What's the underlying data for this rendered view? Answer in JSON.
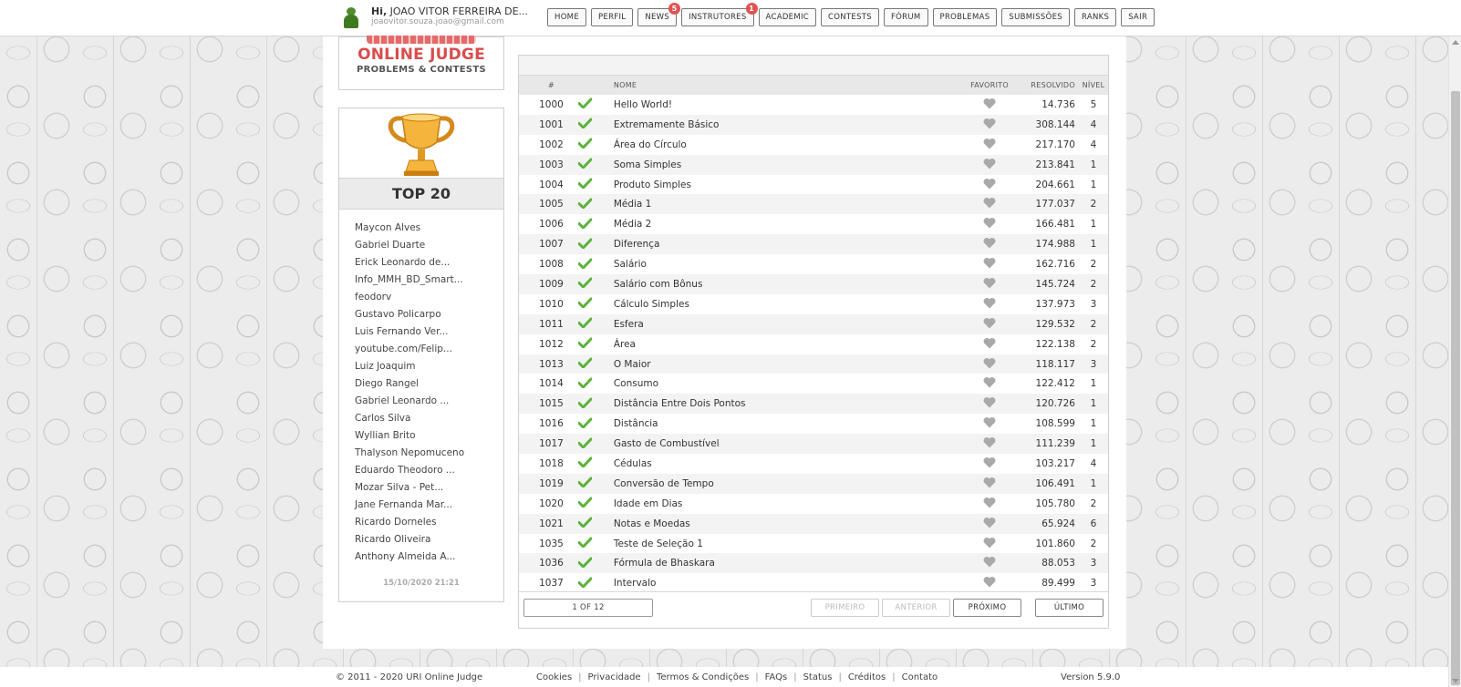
{
  "user": {
    "greeting": "Hi,",
    "name": "JOAO VITOR FERREIRA DE...",
    "email": "joaovitor.souza.joao@gmail.com"
  },
  "nav": [
    {
      "label": "HOME",
      "badge": null
    },
    {
      "label": "PERFIL",
      "badge": null
    },
    {
      "label": "NEWS",
      "badge": "5"
    },
    {
      "label": "INSTRUTORES",
      "badge": "1"
    },
    {
      "label": "ACADEMIC",
      "badge": null
    },
    {
      "label": "CONTESTS",
      "badge": null
    },
    {
      "label": "FÓRUM",
      "badge": null
    },
    {
      "label": "PROBLEMAS",
      "badge": null
    },
    {
      "label": "SUBMISSÕES",
      "badge": null
    },
    {
      "label": "RANKS",
      "badge": null
    },
    {
      "label": "SAIR",
      "badge": null
    }
  ],
  "logo": {
    "title": "ONLINE JUDGE",
    "subtitle": "PROBLEMS & CONTESTS"
  },
  "top20": {
    "title": "TOP 20",
    "users": [
      "Maycon Alves",
      "Gabriel Duarte",
      "Erick Leonardo de...",
      "Info_MMH_BD_Smart...",
      "feodorv",
      "Gustavo Policarpo",
      "Luis Fernando Ver...",
      "youtube.com/Felip...",
      "Luiz Joaquim",
      "Diego Rangel",
      "Gabriel Leonardo ...",
      "Carlos Silva",
      "Wyllian Brito",
      "Thalyson Nepomuceno",
      "Eduardo Theodoro ...",
      "Mozar Silva - Pet...",
      "Jane Fernanda Mar...",
      "Ricardo Dorneles",
      "Ricardo Oliveira",
      "Anthony Almeida A..."
    ],
    "updated": "15/10/2020 21:21"
  },
  "table": {
    "headers": {
      "id": "#",
      "name": "NOME",
      "fav": "FAVORITO",
      "solved": "RESOLVIDO",
      "level": "NÍVEL"
    },
    "rows": [
      {
        "id": "1000",
        "name": "Hello World!",
        "solved": "14.736",
        "level": "5"
      },
      {
        "id": "1001",
        "name": "Extremamente Básico",
        "solved": "308.144",
        "level": "4"
      },
      {
        "id": "1002",
        "name": "Área do Círculo",
        "solved": "217.170",
        "level": "4"
      },
      {
        "id": "1003",
        "name": "Soma Simples",
        "solved": "213.841",
        "level": "1"
      },
      {
        "id": "1004",
        "name": "Produto Simples",
        "solved": "204.661",
        "level": "1"
      },
      {
        "id": "1005",
        "name": "Média 1",
        "solved": "177.037",
        "level": "2"
      },
      {
        "id": "1006",
        "name": "Média 2",
        "solved": "166.481",
        "level": "1"
      },
      {
        "id": "1007",
        "name": "Diferença",
        "solved": "174.988",
        "level": "1"
      },
      {
        "id": "1008",
        "name": "Salário",
        "solved": "162.716",
        "level": "2"
      },
      {
        "id": "1009",
        "name": "Salário com Bônus",
        "solved": "145.724",
        "level": "2"
      },
      {
        "id": "1010",
        "name": "Cálculo Simples",
        "solved": "137.973",
        "level": "3"
      },
      {
        "id": "1011",
        "name": "Esfera",
        "solved": "129.532",
        "level": "2"
      },
      {
        "id": "1012",
        "name": "Área",
        "solved": "122.138",
        "level": "2"
      },
      {
        "id": "1013",
        "name": "O Maior",
        "solved": "118.117",
        "level": "3"
      },
      {
        "id": "1014",
        "name": "Consumo",
        "solved": "122.412",
        "level": "1"
      },
      {
        "id": "1015",
        "name": "Distância Entre Dois Pontos",
        "solved": "120.726",
        "level": "1"
      },
      {
        "id": "1016",
        "name": "Distância",
        "solved": "108.599",
        "level": "1"
      },
      {
        "id": "1017",
        "name": "Gasto de Combustível",
        "solved": "111.239",
        "level": "1"
      },
      {
        "id": "1018",
        "name": "Cédulas",
        "solved": "103.217",
        "level": "4"
      },
      {
        "id": "1019",
        "name": "Conversão de Tempo",
        "solved": "106.491",
        "level": "1"
      },
      {
        "id": "1020",
        "name": "Idade em Dias",
        "solved": "105.780",
        "level": "2"
      },
      {
        "id": "1021",
        "name": "Notas e Moedas",
        "solved": "65.924",
        "level": "6"
      },
      {
        "id": "1035",
        "name": "Teste de Seleção 1",
        "solved": "101.860",
        "level": "2"
      },
      {
        "id": "1036",
        "name": "Fórmula de Bhaskara",
        "solved": "88.053",
        "level": "3"
      },
      {
        "id": "1037",
        "name": "Intervalo",
        "solved": "89.499",
        "level": "3"
      }
    ]
  },
  "pager": {
    "info": "1 OF 12",
    "first": "PRIMEIRO",
    "prev": "ANTERIOR",
    "next": "PRÓXIMO",
    "last": "ÚLTIMO"
  },
  "footer": {
    "copyright": "© 2011 - 2020 URI Online Judge",
    "links": [
      "Cookies",
      "Privacidade",
      "Termos & Condições",
      "FAQs",
      "Status",
      "Créditos",
      "Contato"
    ],
    "version": "Version 5.9.0"
  },
  "colors": {
    "check": "#5bb33a",
    "heart": "#a9a9a9",
    "logo_red": "#d94d4d",
    "badge": "#e05353"
  },
  "icons": {
    "solved": "check-icon",
    "favorite": "heart-icon",
    "trophy": "trophy-icon"
  }
}
